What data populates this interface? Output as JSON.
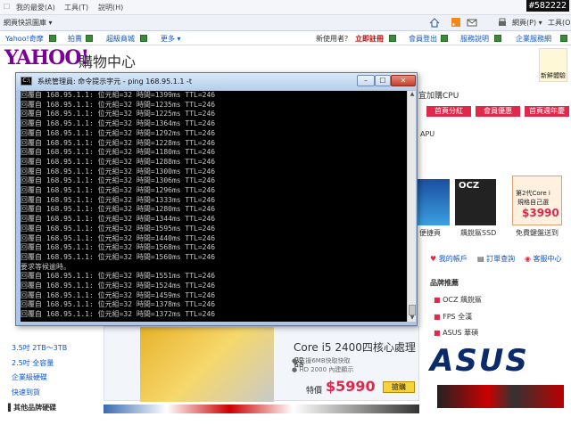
{
  "ie_menu": {
    "items": [
      "我的最愛(A)",
      "工具(T)",
      "說明(H)"
    ],
    "badge": "#582222"
  },
  "command_bar": {
    "favorite": "網頁快訊圖庫 ▾",
    "page_menu": "網頁(P) ▾",
    "tools_menu": "工具(O) ▾"
  },
  "yahoo_nav": {
    "links": [
      "Yahoo!奇摩",
      "拍賣",
      "超級商城",
      "更多 ▾"
    ],
    "new_user": "新使用者？",
    "register": "立即註冊",
    "right_links": [
      "會員登出",
      "服務說明",
      "企業服務網"
    ]
  },
  "header": {
    "logo": "YAHOO!",
    "subtitle": "購物中心",
    "newbie": "新鮮體驗"
  },
  "page_bg": {
    "cpu_label": "宜加購CPU",
    "tabs": [
      "首頁分紅",
      "會員優惠",
      "首頁週年慶"
    ],
    "apu_label": "APU",
    "products": [
      "便捷頁",
      "飆銳鯊SSD",
      "免費鍵盤送到"
    ],
    "ocz_brand": "OCZ",
    "second_gen": "第2代Core i",
    "second_gen_sub": "規格自己選",
    "second_gen_price": "$3990",
    "account_links": [
      "我的帳戶",
      "訂單查詢",
      "客服中心"
    ],
    "brand_title": "品牌推薦",
    "brand_links": [
      "OCZ 飆銳鯊",
      "FPS 全漢",
      "ASUS 華碩"
    ],
    "left_links": [
      "3.5吋 2TB～3TB",
      "2.5吋 全容量",
      "企業級硬碟",
      "快速到貨",
      "▌其他品牌硬碟"
    ],
    "asus_logo": "ASUS"
  },
  "cpu_ad": {
    "title": "Core i5 2400四核心處理器",
    "features": "● 支援6MB快取快取\n● HD 2000 內建顯示",
    "price_label": "特價",
    "price": "$5990",
    "grab": "搶購"
  },
  "cmd_window": {
    "title": "系統管理員: 命令提示字元 - ping  168.95.1.1 -t",
    "lines": [
      "回覆自 168.95.1.1: 位元組=32 時間=1399ms TTL=246",
      "回覆自 168.95.1.1: 位元組=32 時間=1235ms TTL=246",
      "回覆自 168.95.1.1: 位元組=32 時間=1225ms TTL=246",
      "回覆自 168.95.1.1: 位元組=32 時間=1364ms TTL=246",
      "回覆自 168.95.1.1: 位元組=32 時間=1292ms TTL=246",
      "回覆自 168.95.1.1: 位元組=32 時間=1228ms TTL=246",
      "回覆自 168.95.1.1: 位元組=32 時間=1180ms TTL=246",
      "回覆自 168.95.1.1: 位元組=32 時間=1288ms TTL=246",
      "回覆自 168.95.1.1: 位元組=32 時間=1300ms TTL=246",
      "回覆自 168.95.1.1: 位元組=32 時間=1306ms TTL=246",
      "回覆自 168.95.1.1: 位元組=32 時間=1296ms TTL=246",
      "回覆自 168.95.1.1: 位元組=32 時間=1333ms TTL=246",
      "回覆自 168.95.1.1: 位元組=32 時間=1280ms TTL=246",
      "回覆自 168.95.1.1: 位元組=32 時間=1344ms TTL=246",
      "回覆自 168.95.1.1: 位元組=32 時間=1595ms TTL=246",
      "回覆自 168.95.1.1: 位元組=32 時間=1440ms TTL=246",
      "回覆自 168.95.1.1: 位元組=32 時間=1568ms TTL=246",
      "回覆自 168.95.1.1: 位元組=32 時間=1560ms TTL=246",
      "要求等候逾時。",
      "回覆自 168.95.1.1: 位元組=32 時間=1551ms TTL=246",
      "回覆自 168.95.1.1: 位元組=32 時間=1524ms TTL=246",
      "回覆自 168.95.1.1: 位元組=32 時間=1459ms TTL=246",
      "回覆自 168.95.1.1: 位元組=32 時間=1378ms TTL=246",
      "回覆自 168.95.1.1: 位元組=32 時間=1372ms TTL=246"
    ]
  }
}
